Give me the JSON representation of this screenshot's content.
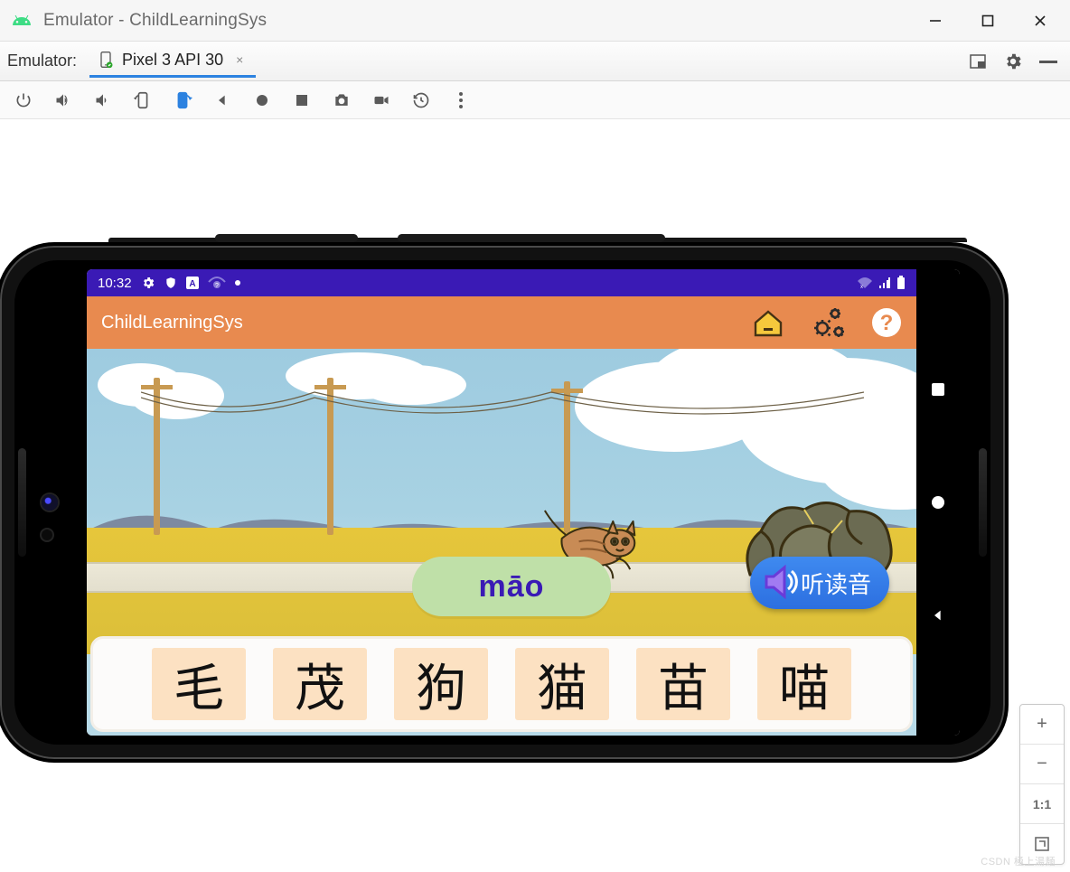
{
  "window": {
    "title": "Emulator - ChildLearningSys"
  },
  "tabrow": {
    "label": "Emulator:",
    "tab_label": "Pixel 3 API 30"
  },
  "statusbar": {
    "time": "10:32"
  },
  "appbar": {
    "title": "ChildLearningSys"
  },
  "game": {
    "pinyin": "māo",
    "listen_label": "听读音",
    "choices": [
      "毛",
      "茂",
      "狗",
      "猫",
      "苗",
      "喵"
    ]
  },
  "zoom": {
    "plus": "+",
    "minus": "−",
    "fit": "1:1"
  },
  "watermark": "CSDN 極上湯麵"
}
